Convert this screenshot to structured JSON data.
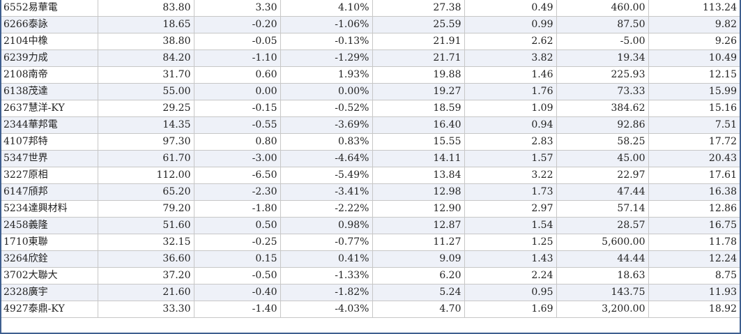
{
  "colors": {
    "up": "#e03030",
    "down": "#2e8b2e",
    "neutral": "#222222",
    "row_alt": "#eef1f8",
    "frame": "#3f5f8f"
  },
  "rows": [
    {
      "name": "6552易華電",
      "price": "83.80",
      "change": "3.30",
      "pct": "4.10%",
      "v1": "27.38",
      "v2": "0.49",
      "v3": "460.00",
      "v4": "113.24",
      "dir": "up",
      "v3dir": "flat"
    },
    {
      "name": "6266泰詠",
      "price": "18.65",
      "change": "-0.20",
      "pct": "-1.06%",
      "v1": "25.59",
      "v2": "0.99",
      "v3": "87.50",
      "v4": "9.82",
      "dir": "down",
      "v3dir": "flat"
    },
    {
      "name": "2104中橡",
      "price": "38.80",
      "change": "-0.05",
      "pct": "-0.13%",
      "v1": "21.91",
      "v2": "2.62",
      "v3": "-5.00",
      "v4": "9.26",
      "dir": "down",
      "v3dir": "up"
    },
    {
      "name": "6239力成",
      "price": "84.20",
      "change": "-1.10",
      "pct": "-1.29%",
      "v1": "21.71",
      "v2": "3.82",
      "v3": "19.34",
      "v4": "10.49",
      "dir": "down",
      "v3dir": "flat"
    },
    {
      "name": "2108南帝",
      "price": "31.70",
      "change": "0.60",
      "pct": "1.93%",
      "v1": "19.88",
      "v2": "1.46",
      "v3": "225.93",
      "v4": "12.15",
      "dir": "up",
      "v3dir": "flat"
    },
    {
      "name": "6138茂達",
      "price": "55.00",
      "change": "0.00",
      "pct": "0.00%",
      "v1": "19.27",
      "v2": "1.76",
      "v3": "73.33",
      "v4": "15.99",
      "dir": "flat",
      "v3dir": "flat"
    },
    {
      "name": "2637慧洋-KY",
      "price": "29.25",
      "change": "-0.15",
      "pct": "-0.52%",
      "v1": "18.59",
      "v2": "1.09",
      "v3": "384.62",
      "v4": "15.16",
      "dir": "down",
      "v3dir": "flat"
    },
    {
      "name": "2344華邦電",
      "price": "14.35",
      "change": "-0.55",
      "pct": "-3.69%",
      "v1": "16.40",
      "v2": "0.94",
      "v3": "92.86",
      "v4": "7.51",
      "dir": "down",
      "v3dir": "flat"
    },
    {
      "name": "4107邦特",
      "price": "97.30",
      "change": "0.80",
      "pct": "0.83%",
      "v1": "15.55",
      "v2": "2.83",
      "v3": "58.25",
      "v4": "17.72",
      "dir": "up",
      "v3dir": "flat"
    },
    {
      "name": "5347世界",
      "price": "61.70",
      "change": "-3.00",
      "pct": "-4.64%",
      "v1": "14.11",
      "v2": "1.57",
      "v3": "45.00",
      "v4": "20.43",
      "dir": "down",
      "v3dir": "flat"
    },
    {
      "name": "3227原相",
      "price": "112.00",
      "change": "-6.50",
      "pct": "-5.49%",
      "v1": "13.84",
      "v2": "3.22",
      "v3": "22.97",
      "v4": "17.61",
      "dir": "down",
      "v3dir": "flat"
    },
    {
      "name": "6147頎邦",
      "price": "65.20",
      "change": "-2.30",
      "pct": "-3.41%",
      "v1": "12.98",
      "v2": "1.73",
      "v3": "47.44",
      "v4": "16.38",
      "dir": "down",
      "v3dir": "flat"
    },
    {
      "name": "5234達興材料",
      "price": "79.20",
      "change": "-1.80",
      "pct": "-2.22%",
      "v1": "12.90",
      "v2": "2.97",
      "v3": "57.14",
      "v4": "12.86",
      "dir": "down",
      "v3dir": "flat"
    },
    {
      "name": "2458義隆",
      "price": "51.60",
      "change": "0.50",
      "pct": "0.98%",
      "v1": "12.87",
      "v2": "1.54",
      "v3": "28.57",
      "v4": "16.75",
      "dir": "up",
      "v3dir": "flat"
    },
    {
      "name": "1710東聯",
      "price": "32.15",
      "change": "-0.25",
      "pct": "-0.77%",
      "v1": "11.27",
      "v2": "1.25",
      "v3": "5,600.00",
      "v4": "11.78",
      "dir": "down",
      "v3dir": "flat"
    },
    {
      "name": "3264欣銓",
      "price": "36.60",
      "change": "0.15",
      "pct": "0.41%",
      "v1": "9.09",
      "v2": "1.43",
      "v3": "44.44",
      "v4": "12.24",
      "dir": "up",
      "v3dir": "flat"
    },
    {
      "name": "3702大聯大",
      "price": "37.20",
      "change": "-0.50",
      "pct": "-1.33%",
      "v1": "6.20",
      "v2": "2.24",
      "v3": "18.63",
      "v4": "8.75",
      "dir": "down",
      "v3dir": "flat"
    },
    {
      "name": "2328廣宇",
      "price": "21.60",
      "change": "-0.40",
      "pct": "-1.82%",
      "v1": "5.24",
      "v2": "0.95",
      "v3": "143.75",
      "v4": "11.93",
      "dir": "down",
      "v3dir": "flat"
    },
    {
      "name": "4927泰鼎-KY",
      "price": "33.30",
      "change": "-1.40",
      "pct": "-4.03%",
      "v1": "4.70",
      "v2": "1.69",
      "v3": "3,200.00",
      "v4": "18.92",
      "dir": "down",
      "v3dir": "flat"
    }
  ]
}
